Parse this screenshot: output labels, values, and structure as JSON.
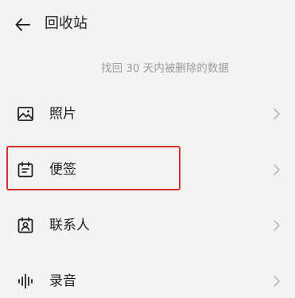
{
  "header": {
    "title": "回收站",
    "back_icon": "arrow-left-icon"
  },
  "subtitle": "找回 30 天内被删除的数据",
  "items": [
    {
      "label": "照片",
      "icon": "image-icon"
    },
    {
      "label": "便签",
      "icon": "calendar-notes-icon"
    },
    {
      "label": "联系人",
      "icon": "contact-icon"
    },
    {
      "label": "录音",
      "icon": "audio-wave-icon"
    }
  ],
  "colors": {
    "background": "#f3f3f4",
    "text": "#222222",
    "subtle_text": "#9a9a9a",
    "chevron": "#b8b8b8",
    "highlight": "#d9302c"
  }
}
